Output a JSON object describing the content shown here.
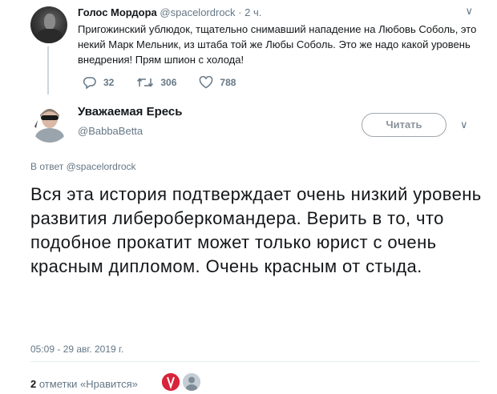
{
  "parent_tweet": {
    "name": "Голос Мордора",
    "handle": "@spacelordrock",
    "separator": "·",
    "time": "2 ч.",
    "caret": "∨",
    "text": "Пригожинский ублюдок, тщательно снимавший нападение на Любовь Соболь, это некий Марк Мельник, из штаба той же Любы Соболь. Это же надо какой уровень внедрения! Прям шпион с холода!",
    "replies": "32",
    "retweets": "306",
    "likes": "788"
  },
  "tweet": {
    "name": "Уважаемая Ересь",
    "handle": "@BabbaBetta",
    "read_button": "Читать",
    "caret": "∨",
    "reply_prefix": "В ответ",
    "reply_handle": "@spacelordrock",
    "text": "Вся эта история подтверждает очень низкий уровень развития либероберкомандера. Верить в то, что подобное прокатит может только юрист с очень красным дипломом. Очень красным от стыда.",
    "timestamp": "05:09 - 29 авг. 2019 г.",
    "likes_count": "2",
    "likes_label": "отметки «Нравится»"
  },
  "colors": {
    "text": "#14171a",
    "muted": "#657786",
    "border": "#e6ecf0",
    "button_border": "#9fa7ae"
  }
}
